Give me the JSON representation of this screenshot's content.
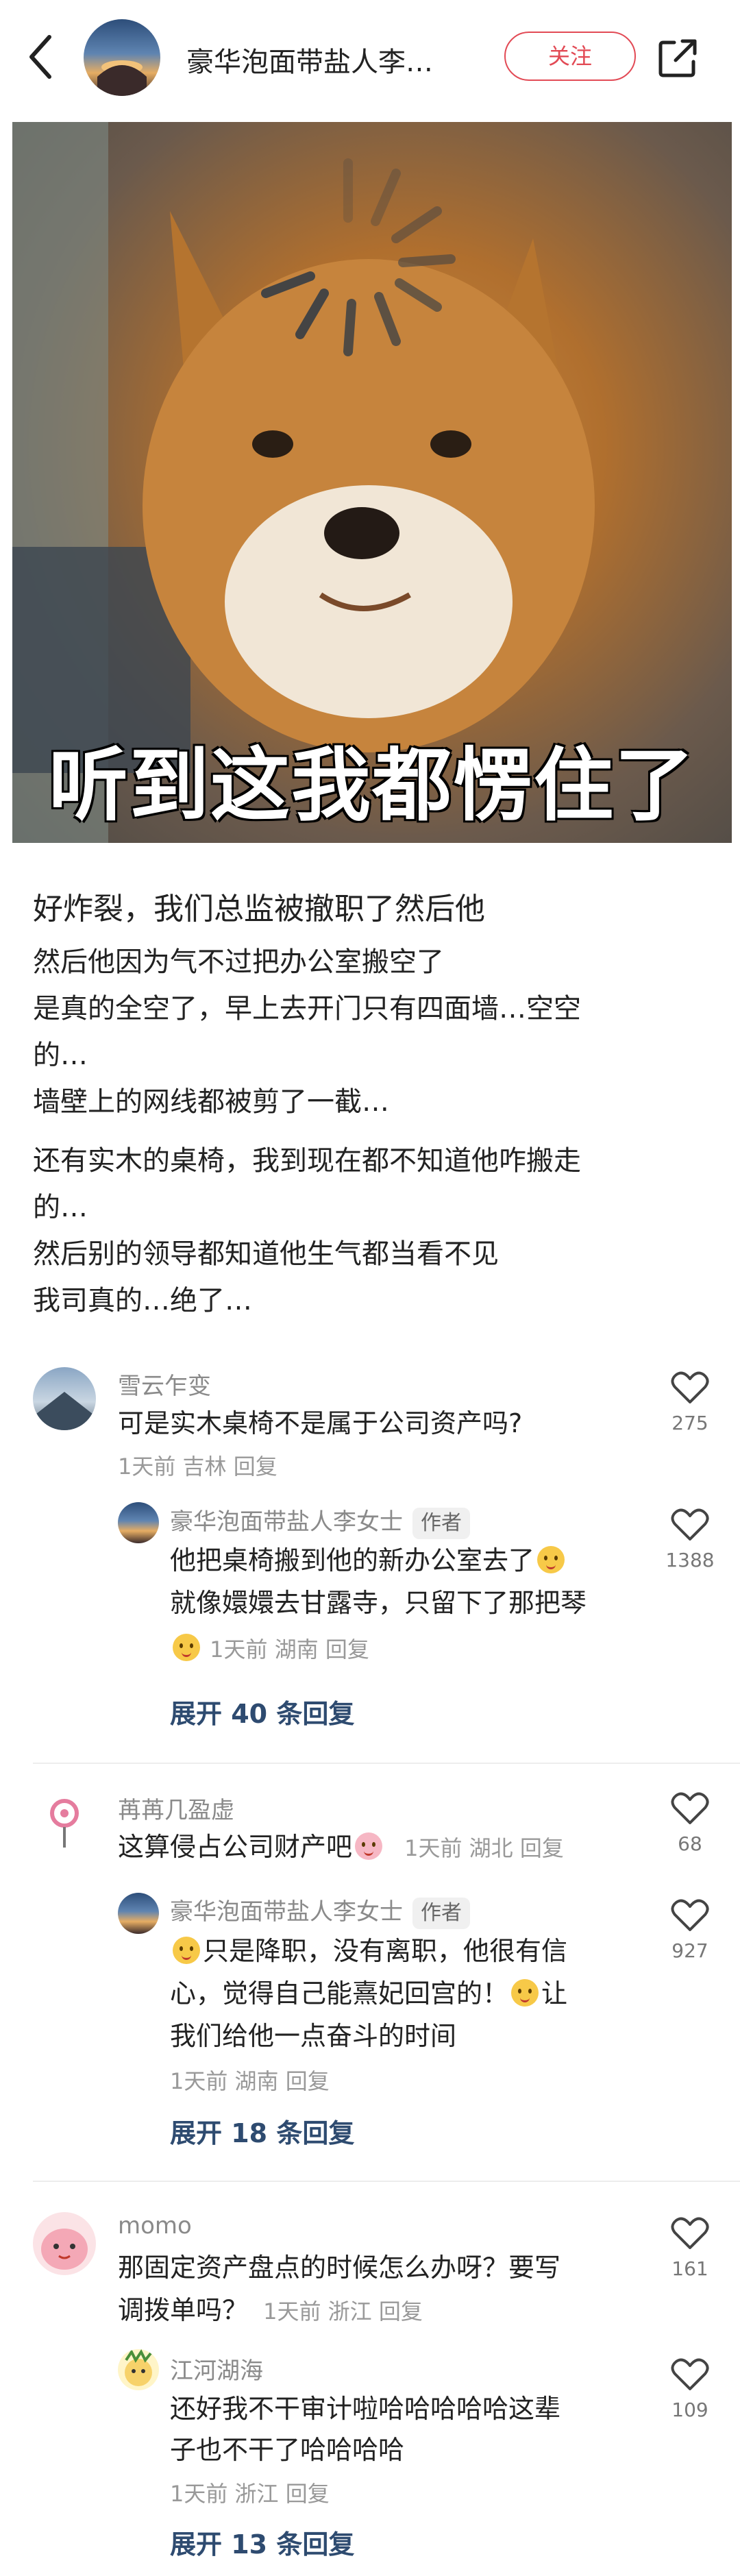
{
  "header": {
    "nickname": "豪华泡面带盐人李…",
    "follow_label": "关注"
  },
  "meme": {
    "caption": "听到这我都愣住了"
  },
  "post": {
    "title": "好炸裂，我们总监被撤职了然后他",
    "para1": [
      "然后他因为气不过把办公室搬空了",
      "是真的全空了，早上去开门只有四面墙…空空",
      "的…",
      "墙壁上的网线都被剪了一截…"
    ],
    "para2": [
      "还有实木的桌椅，我到现在都不知道他咋搬走",
      "的…",
      "然后别的领导都知道他生气都当看不见",
      "我司真的…绝了…"
    ]
  },
  "comments": [
    {
      "name": "雪云乍变",
      "text": "可是实木桌椅不是属于公司资产吗?",
      "meta": "1天前 吉林 回复",
      "likes": "275",
      "reply": {
        "name": "豪华泡面带盐人李女士",
        "tag": "作者",
        "line1": "他把桌椅搬到他的新办公室去了",
        "line2": "就像嬛嬛去甘露寺，只留下了那把琴",
        "meta": "1天前 湖南 回复",
        "likes": "1388"
      },
      "expand": "展开 40 条回复"
    },
    {
      "name": "苒苒几盈虚",
      "text": "这算侵占公司财产吧",
      "meta": "1天前 湖北 回复",
      "likes": "68",
      "reply": {
        "name": "豪华泡面带盐人李女士",
        "tag": "作者",
        "line1": "只是降职，没有离职，他很有信",
        "line2": "心，觉得自己能熹妃回宫的！",
        "line2b": "让",
        "line3": "我们给他一点奋斗的时间",
        "meta": "1天前 湖南 回复",
        "likes": "927"
      },
      "expand": "展开 18 条回复"
    },
    {
      "name": "momo",
      "text1": "那固定资产盘点的时候怎么办呀？要写",
      "text2": "调拨单吗？",
      "meta": "1天前 浙江 回复",
      "likes": "161",
      "reply": {
        "name": "江河湖海",
        "line1": "还好我不干审计啦哈哈哈哈哈这辈",
        "line2": "子也不干了哈哈哈哈",
        "meta": "1天前 浙江 回复",
        "likes": "109"
      },
      "expand": "展开 13 条回复"
    }
  ]
}
